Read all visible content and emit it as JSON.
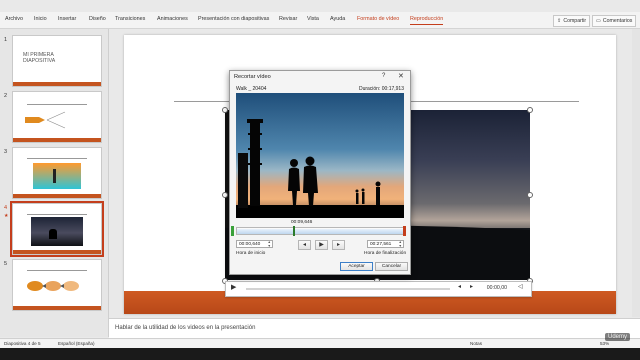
{
  "ribbon": {
    "tabs": [
      "Archivo",
      "Inicio",
      "Insertar",
      "Diseño",
      "Transiciones",
      "Animaciones",
      "Presentación con diapositivas",
      "Revisar",
      "Vista",
      "Ayuda",
      "Formato de vídeo",
      "Reproducción"
    ],
    "active_tab": "Reproducción",
    "share_label": "Compartir",
    "comments_label": "Comentarios"
  },
  "slides_pane": {
    "numbers": [
      "1",
      "2",
      "3",
      "4",
      "5"
    ],
    "slide1_title": "MI PRIMERA DIAPOSITIVA",
    "selected_slide": "4"
  },
  "player": {
    "play_icon": "play-icon",
    "time": "00:00,00"
  },
  "dialog": {
    "title": "Recortar vídeo",
    "help_icon": "?",
    "close_icon": "✕",
    "video_name": "Walk _ 20404",
    "duration_label": "Duración: 00:17,913",
    "current_time": "00:09,646",
    "start_time": "00:00,640",
    "end_time": "00:27,561",
    "start_label": "Hora de inicio",
    "end_label": "Hora de finalización",
    "accept_label": "Aceptar",
    "cancel_label": "Cancelar"
  },
  "notes": {
    "text": "Hablar de la utilidad de los videos en la presentación"
  },
  "status": {
    "slide_info": "Diapositiva 4 de 5",
    "language": "Español (España)",
    "notes_label": "Notas",
    "zoom": "53%"
  },
  "watermark": "Udemy",
  "colors": {
    "accent": "#c43e1c",
    "orange_bar": "#c4541f"
  }
}
